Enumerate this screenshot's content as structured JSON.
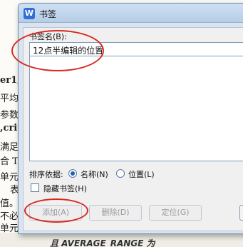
{
  "background_document": {
    "lines": [
      "er1,",
      "平均",
      "参数",
      ",crit",
      "满足",
      "合 TR",
      "单元格",
      "表",
      "值。",
      "不必",
      "单元"
    ],
    "bottom_text": "且 AVERAGE_RANGE 为"
  },
  "dialog": {
    "app_icon": "W",
    "title": "书签",
    "name_label": "书签名(B):",
    "name_value": "12点半编辑的位置",
    "sort_label": "排序依据:",
    "sort_options": [
      {
        "label": "名称(N)",
        "checked": true
      },
      {
        "label": "位置(L)",
        "checked": false
      }
    ],
    "hidden_label": "隐藏书签(H)",
    "hidden_checked": false,
    "buttons": {
      "add": "添加(A)",
      "delete": "删除(D)",
      "locate": "定位(G)"
    }
  },
  "colors": {
    "annotation": "#d8281f",
    "dialog_bg": "#d9e4f0",
    "icon": "#2f6fd6"
  }
}
